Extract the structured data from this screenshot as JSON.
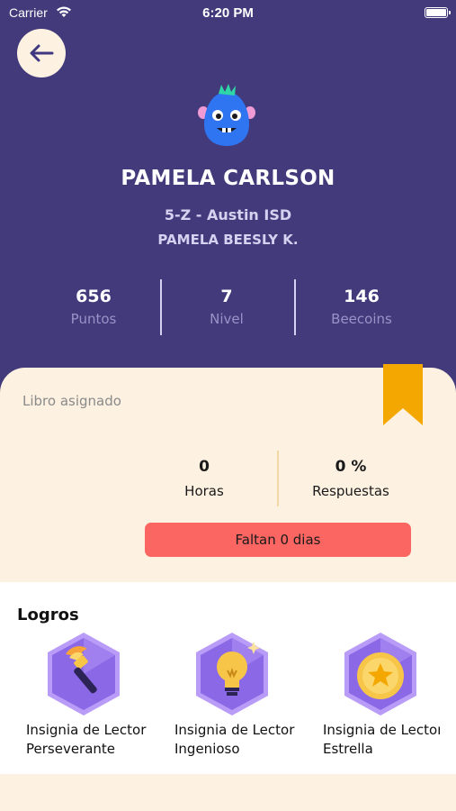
{
  "status_bar": {
    "carrier": "Carrier",
    "time": "6:20 PM"
  },
  "profile": {
    "name": "PAMELA CARLSON",
    "school": "5-Z - Austin ISD",
    "teacher": "PAMELA BEESLY K."
  },
  "stats": [
    {
      "value": "656",
      "label": "Puntos"
    },
    {
      "value": "7",
      "label": "Nivel"
    },
    {
      "value": "146",
      "label": "Beecoins"
    }
  ],
  "book": {
    "label": "Libro asignado",
    "stats": [
      {
        "value": "0",
        "label": "Horas"
      },
      {
        "value": "0 %",
        "label": "Respuestas"
      }
    ],
    "countdown": "Faltan 0 dias"
  },
  "achievements": {
    "title": "Logros",
    "items": [
      {
        "line1": "Insignia de Lector",
        "line2": "Perseverante",
        "icon": "torch-icon"
      },
      {
        "line1": "Insignia de Lector",
        "line2": "Ingenioso",
        "icon": "lightbulb-icon"
      },
      {
        "line1": "Insignia de Lector",
        "line2": "Estrella",
        "icon": "star-coin-icon"
      }
    ]
  },
  "colors": {
    "header": "#433a7c",
    "cream": "#fdf1e1",
    "accent": "#f4a700",
    "countdown": "#fb6662",
    "badge": "#8b68e6"
  }
}
